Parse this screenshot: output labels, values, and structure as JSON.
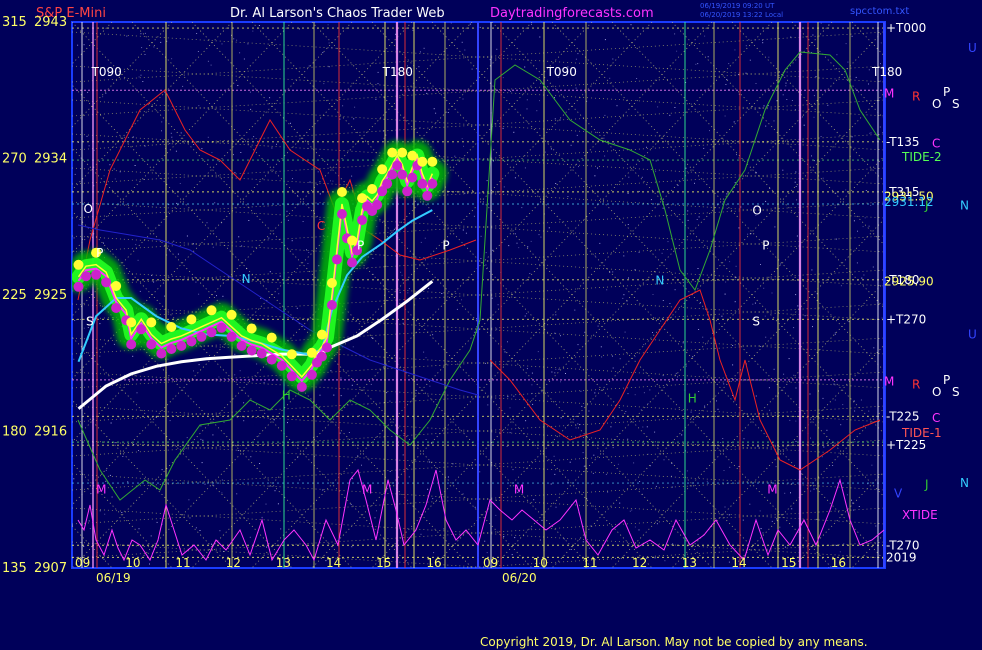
{
  "header": {
    "instrument": "S&P E-Mini",
    "site": "Dr. Al Larson's Chaos Trader Web",
    "link": "Daytradingforecasts.com",
    "timestamp1": "06/19/2019 09:20 UT",
    "timestamp2": "06/20/2019 13:22 Local",
    "file": "spcctom.txt"
  },
  "copyright": "Copyright 2019, Dr. Al Larson. May not be copied by any means.",
  "colors": {
    "background": "#00005a",
    "frame": "#1a3cff",
    "yellow_text": "#ffff66",
    "white_text": "#ffffff",
    "magenta_text": "#ff33ff",
    "cyan_line": "#33ccff",
    "green_glow": "#00cc00"
  },
  "chart_data": {
    "type": "line",
    "y_axis": {
      "ylim": [
        2907,
        2943
      ],
      "ticks": [
        {
          "angle": "315",
          "price": "2943",
          "value": 2943
        },
        {
          "angle": "270",
          "price": "2934",
          "value": 2934
        },
        {
          "angle": "225",
          "price": "2925",
          "value": 2925
        },
        {
          "angle": "180",
          "price": "2916",
          "value": 2916
        },
        {
          "angle": "135",
          "price": "2907",
          "value": 2907
        }
      ]
    },
    "x_axis": {
      "xlim": [
        8.9,
        16.95
      ],
      "day1": {
        "label": "06/19",
        "hour_ticks": [
          "09",
          "10",
          "11",
          "12",
          "13",
          "14",
          "15",
          "16"
        ]
      },
      "day2": {
        "label": "06/20",
        "hour_ticks": [
          "09",
          "10",
          "11",
          "12",
          "13",
          "14",
          "15",
          "16"
        ]
      },
      "day_break": 9.0
    },
    "series": [
      {
        "role": "price",
        "x": [
          8.95,
          9.1,
          9.3,
          9.5,
          9.7,
          9.9,
          10.0,
          10.2,
          10.4,
          10.6,
          10.8,
          11.0,
          11.2,
          11.4,
          11.6,
          11.8,
          12.0,
          12.2,
          12.4,
          12.6,
          12.8,
          13.0,
          13.2,
          13.4,
          13.6,
          13.7,
          13.8,
          13.9,
          14.0,
          14.1,
          14.2,
          14.3,
          14.4,
          14.5,
          14.6,
          14.7,
          14.8,
          14.9,
          15.0,
          15.1,
          15.2,
          15.3,
          15.4,
          15.5,
          15.6,
          15.7,
          15.8,
          15.9,
          16.0
        ],
        "y": [
          2926.2,
          2926.9,
          2927.0,
          2926.5,
          2924.8,
          2924.0,
          2922.4,
          2923.4,
          2922.4,
          2921.8,
          2922.1,
          2922.3,
          2922.6,
          2922.9,
          2923.2,
          2923.5,
          2922.9,
          2922.3,
          2922.0,
          2921.8,
          2921.4,
          2921.0,
          2920.3,
          2919.6,
          2920.4,
          2921.2,
          2921.6,
          2922.2,
          2925.0,
          2928.0,
          2931.0,
          2929.4,
          2927.8,
          2928.6,
          2930.6,
          2931.5,
          2931.2,
          2931.6,
          2932.5,
          2933.0,
          2933.6,
          2934.2,
          2933.6,
          2932.5,
          2933.4,
          2934.2,
          2933.0,
          2932.2,
          2933.0
        ]
      },
      {
        "role": "cyan average",
        "x": [
          8.95,
          9.3,
          9.7,
          10.0,
          10.5,
          11.0,
          11.5,
          12.0,
          12.5,
          13.0,
          13.5,
          13.8,
          14.0,
          14.3,
          14.6,
          15.0,
          15.3,
          15.6,
          16.0
        ],
        "y": [
          2920.6,
          2923.6,
          2924.8,
          2924.8,
          2923.6,
          2922.8,
          2922.4,
          2922.3,
          2921.9,
          2921.4,
          2921.1,
          2921.4,
          2924.0,
          2926.3,
          2927.5,
          2928.4,
          2929.2,
          2929.9,
          2930.6
        ]
      },
      {
        "role": "white average",
        "x": [
          8.95,
          9.5,
          10.0,
          10.5,
          11.0,
          11.5,
          12.0,
          12.5,
          13.0,
          13.5,
          13.8,
          14.0,
          14.5,
          15.0,
          15.5,
          16.0
        ],
        "y": [
          2917.5,
          2919.0,
          2919.8,
          2920.3,
          2920.6,
          2920.8,
          2920.9,
          2921.0,
          2921.1,
          2921.1,
          2921.2,
          2921.6,
          2922.3,
          2923.4,
          2924.6,
          2925.9
        ]
      }
    ],
    "price_labels": [
      {
        "text": "2931.50",
        "value": 2931.5
      },
      {
        "text": "2931.12",
        "value": 2931.12
      },
      {
        "text": "2925.90",
        "value": 2925.9
      }
    ],
    "right_line_labels": [
      {
        "text": "+T000",
        "value": 2942.6
      },
      {
        "text": "-T135",
        "value": 2935.1
      },
      {
        "text": "-T315",
        "value": 2931.8
      },
      {
        "text": "-T180",
        "value": 2926.0
      },
      {
        "text": "+T270",
        "value": 2923.4
      },
      {
        "text": "-T225",
        "value": 2917.0
      },
      {
        "text": "+T225",
        "value": 2915.1
      },
      {
        "text": "-T270",
        "value": 2908.5
      },
      {
        "text": "2019",
        "value": 2907.7
      }
    ],
    "right_tide_labels": [
      {
        "text": "TIDE-2",
        "value": 2934.1
      },
      {
        "text": "TIDE-1",
        "value": 2915.9
      },
      {
        "text": "XTIDE",
        "value": 2910.5
      }
    ],
    "turn_labels": [
      {
        "text": "T090",
        "x": 9.25
      },
      {
        "text": "T180",
        "x": 15.05
      },
      {
        "text": "T090",
        "x": 10.2
      },
      {
        "text": "T180",
        "x": 16.75
      }
    ],
    "right_letters": [
      {
        "text": "U",
        "value": 2941.3,
        "color": "#3344ff"
      },
      {
        "text": "M",
        "value": 2938.3,
        "color": "#ff33ff"
      },
      {
        "text": "R",
        "value": 2938.1,
        "color": "#ff3333"
      },
      {
        "text": "P",
        "value": 2938.4,
        "color": "#ffffff"
      },
      {
        "text": "O",
        "value": 2937.6,
        "color": "#ffffff"
      },
      {
        "text": "S",
        "value": 2937.6,
        "color": "#ffffff"
      },
      {
        "text": "C",
        "value": 2935.0,
        "color": "#ff33ff"
      },
      {
        "text": "N",
        "value": 2930.9,
        "color": "#33ccff"
      },
      {
        "text": "J",
        "value": 2930.9,
        "color": "#33cc33"
      },
      {
        "text": "U",
        "value": 2922.4,
        "color": "#3344ff"
      },
      {
        "text": "M",
        "value": 2919.3,
        "color": "#ff33ff"
      },
      {
        "text": "R",
        "value": 2919.1,
        "color": "#ff3333"
      },
      {
        "text": "P",
        "value": 2919.4,
        "color": "#ffffff"
      },
      {
        "text": "O",
        "value": 2918.6,
        "color": "#ffffff"
      },
      {
        "text": "S",
        "value": 2918.6,
        "color": "#ffffff"
      },
      {
        "text": "C",
        "value": 2916.9,
        "color": "#ff33ff"
      },
      {
        "text": "N",
        "value": 2912.6,
        "color": "#33ccff"
      },
      {
        "text": "J",
        "value": 2912.5,
        "color": "#33cc33"
      },
      {
        "text": "V",
        "value": 2911.9,
        "color": "#3344ff"
      }
    ],
    "in_chart_letters": [
      {
        "text": "O",
        "x": 9.05,
        "value": 2930.4,
        "color": "#ffffff"
      },
      {
        "text": "P",
        "x": 9.3,
        "value": 2927.5,
        "color": "#ffffff"
      },
      {
        "text": "S",
        "x": 9.1,
        "value": 2923.0,
        "color": "#ffffff"
      },
      {
        "text": "M",
        "x": 9.3,
        "value": 2911.9,
        "color": "#ff33ff"
      },
      {
        "text": "N",
        "x": 12.2,
        "value": 2925.8,
        "color": "#33ccff"
      },
      {
        "text": "H",
        "x": 13.0,
        "value": 2918.1,
        "color": "#33cc33"
      },
      {
        "text": "C",
        "x": 13.7,
        "value": 2929.3,
        "color": "#ff3333"
      },
      {
        "text": "P",
        "x": 14.5,
        "value": 2928.0,
        "color": "#ffffff"
      },
      {
        "text": "M",
        "x": 14.6,
        "value": 2911.9,
        "color": "#ff33ff"
      },
      {
        "text": "P",
        "x": 16.2,
        "value": 2928.0,
        "color": "#ffffff"
      },
      {
        "text": "M",
        "x": 9.5,
        "value": 2911.9,
        "color": "#ff33ff"
      },
      {
        "text": "N",
        "x": 12.35,
        "value": 2925.7,
        "color": "#33ccff"
      },
      {
        "text": "H",
        "x": 13.0,
        "value": 2917.9,
        "color": "#33cc33"
      },
      {
        "text": "O",
        "x": 14.3,
        "value": 2930.3,
        "color": "#ffffff"
      },
      {
        "text": "S",
        "x": 14.3,
        "value": 2923.0,
        "color": "#ffffff"
      },
      {
        "text": "P",
        "x": 14.5,
        "value": 2928.0,
        "color": "#ffffff"
      },
      {
        "text": "M",
        "x": 14.6,
        "value": 2911.9,
        "color": "#ff33ff"
      }
    ]
  }
}
